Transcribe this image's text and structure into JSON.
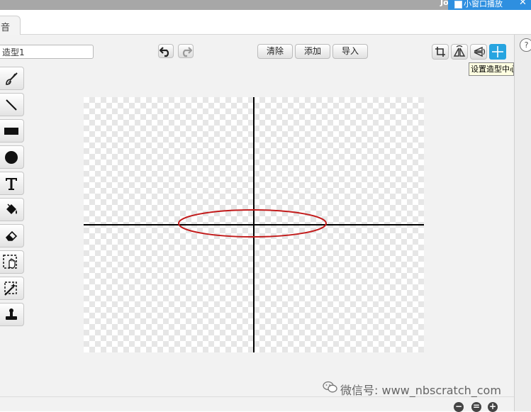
{
  "window": {
    "title_fragment": "Jo",
    "popup_label": "小窗口播放",
    "popup_close": "✕"
  },
  "tab": {
    "label": "音"
  },
  "editor": {
    "costume_name": "造型1",
    "buttons": {
      "clear": "清除",
      "add": "添加",
      "import": "导入"
    },
    "tooltip": "设置造型中心",
    "help": "?"
  },
  "tools": [
    {
      "name": "brush-tool",
      "icon": "brush-icon"
    },
    {
      "name": "line-tool",
      "icon": "line-icon"
    },
    {
      "name": "rectangle-tool",
      "icon": "rectangle-icon"
    },
    {
      "name": "ellipse-tool",
      "icon": "ellipse-icon"
    },
    {
      "name": "text-tool",
      "icon": "text-icon"
    },
    {
      "name": "fill-tool",
      "icon": "paint-bucket-icon"
    },
    {
      "name": "eraser-tool",
      "icon": "eraser-icon"
    },
    {
      "name": "select-tool",
      "icon": "select-hand-icon"
    },
    {
      "name": "magic-select-tool",
      "icon": "magic-wand-icon"
    },
    {
      "name": "stamp-tool",
      "icon": "stamp-icon"
    }
  ],
  "colors": {
    "ellipse_stroke": "#c21a1a",
    "axis_stroke": "#000000",
    "accent": "#27a4e0"
  },
  "watermark": {
    "text": "微信号: www_nbscratch_com"
  },
  "zoom": {
    "out": "−",
    "reset": "=",
    "in": "+"
  }
}
